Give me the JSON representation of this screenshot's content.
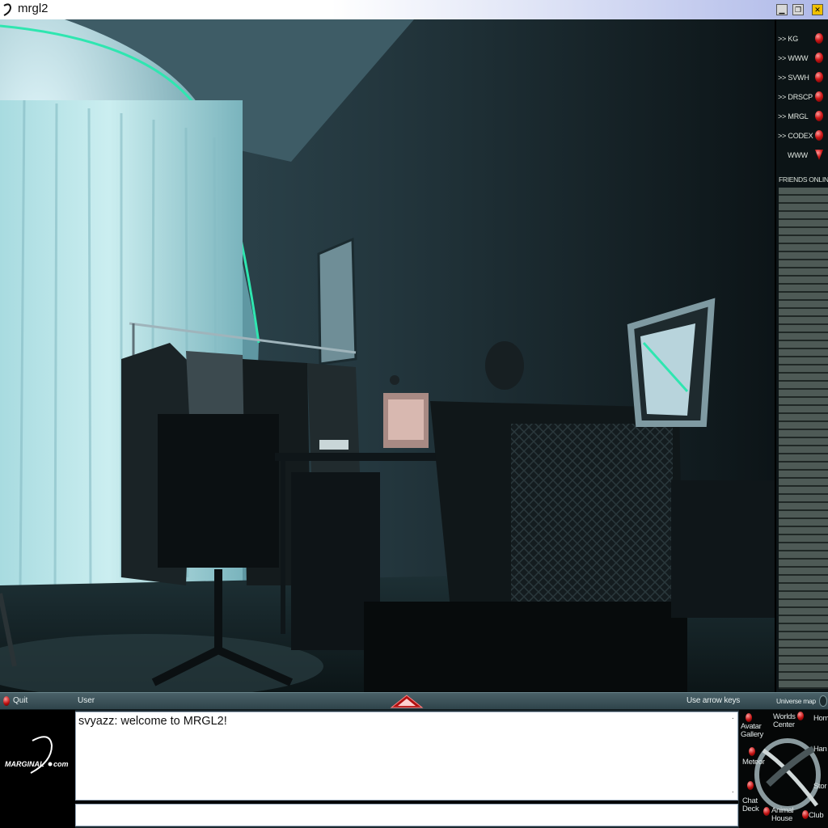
{
  "window": {
    "title": "mrgl2"
  },
  "title_buttons": {
    "minimize": "▁",
    "maximize": "❐",
    "close": "✕"
  },
  "sidebar": {
    "nav_items": [
      {
        "label": ">> KG"
      },
      {
        "label": ">> WWW"
      },
      {
        "label": ">> SVWH"
      },
      {
        "label": ">> DRSCP"
      },
      {
        "label": ">> MRGL"
      },
      {
        "label": ">> CODEX"
      },
      {
        "label": "WWW"
      }
    ],
    "friends_label": "FRIENDS ONLINE:"
  },
  "statusbar": {
    "quit": "Quit",
    "user": "User",
    "hint": "Use arrow keys",
    "universe_map": "Universe map"
  },
  "logo": {
    "text": "MARGINAL",
    "suffix": "com"
  },
  "chat": {
    "messages": [
      "svyazz: welcome to MRGL2!"
    ],
    "input_value": ""
  },
  "world_map": {
    "labels": {
      "worlds_center": "Worlds\nCenter",
      "avatar_gallery": "Avatar\nGallery",
      "meteor": "Meteor",
      "chat_deck": "Chat\nDeck",
      "animal_house": "Animal\nHouse",
      "club": "Club",
      "home": "Hom",
      "hand": "Han",
      "store": "Stor"
    }
  },
  "colors": {
    "accent_gem": "#d01818",
    "glow": "#2fe6b0",
    "statusbar": "#3c555c"
  }
}
